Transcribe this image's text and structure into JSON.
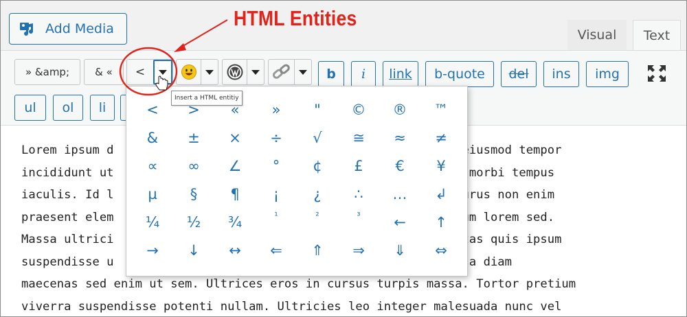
{
  "annotation": {
    "title": "HTML Entities"
  },
  "media": {
    "add_media_label": "Add Media"
  },
  "tabs": {
    "visual": "Visual",
    "text": "Text"
  },
  "toolbar": {
    "raquo_amp": "» &amp;",
    "amp_laquo": "& «",
    "lt": "<",
    "b": "b",
    "i": "i",
    "link": "link",
    "bquote": "b-quote",
    "del": "del",
    "ins": "ins",
    "img": "img",
    "ul": "ul",
    "ol": "ol",
    "li": "li"
  },
  "tooltip": {
    "text": "Insert a HTML entitiy"
  },
  "entities": [
    "<",
    ">",
    "«",
    "»",
    "\"",
    "©",
    "®",
    "™",
    "&",
    "±",
    "×",
    "÷",
    "√",
    "≅",
    "≈",
    "≠",
    "∝",
    "∞",
    "∠",
    "°",
    "¢",
    "£",
    "€",
    "¥",
    "µ",
    "§",
    "¶",
    "¡",
    "¿",
    "∴",
    "…",
    "↲",
    "¼",
    "½",
    "¾",
    "¹",
    "²",
    "³",
    "←",
    "↑",
    "→",
    "↓",
    "↔",
    "⇐",
    "⇑",
    "⇒",
    "⇓",
    "⇔"
  ],
  "editor": {
    "lines": [
      "Lorem ipsum d                                       t, sed do eiusmod tempor",
      "incididunt ut                                       n facilisi morbi tempus",
      "iaculis. Id l                                       us dolor purus non enim",
      "praesent elem                                       s vestibulum lorem sed.",
      "Massa ultrici                                       ue et egestas quis ipsum",
      "suspendisse u                                       nt. Mauris a diam",
      "maecenas sed enim ut sem. Ultrices eros in cursus turpis massa. Tortor pretium",
      "viverra suspendisse potenti nullam. Ultricies leo integer malesuada nunc vel"
    ]
  },
  "colors": {
    "accent": "#2271b1",
    "annotation": "#e0241b"
  }
}
